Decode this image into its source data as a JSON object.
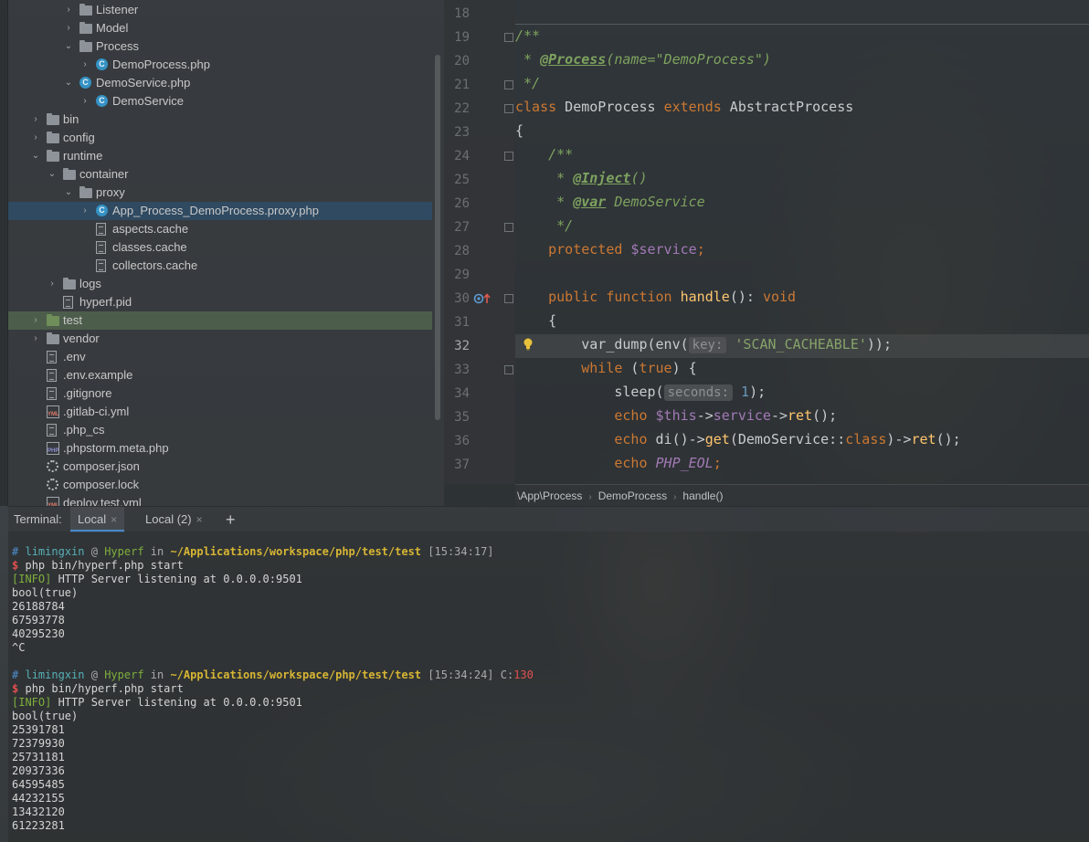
{
  "tree": {
    "items": [
      {
        "label": "Listener",
        "type": "folder",
        "arrow": "›",
        "depth": 3
      },
      {
        "label": "Model",
        "type": "folder",
        "arrow": "›",
        "depth": 3
      },
      {
        "label": "Process",
        "type": "folder",
        "arrow": "⌄",
        "depth": 3
      },
      {
        "label": "DemoProcess.php",
        "type": "class",
        "arrow": "›",
        "depth": 4
      },
      {
        "label": "DemoService.php",
        "type": "class",
        "arrow": "⌄",
        "depth": 3
      },
      {
        "label": "DemoService",
        "type": "class",
        "arrow": "›",
        "depth": 4
      },
      {
        "label": "bin",
        "type": "folder",
        "arrow": "›",
        "depth": 1
      },
      {
        "label": "config",
        "type": "folder",
        "arrow": "›",
        "depth": 1
      },
      {
        "label": "runtime",
        "type": "folder",
        "arrow": "⌄",
        "depth": 1
      },
      {
        "label": "container",
        "type": "folder",
        "arrow": "⌄",
        "depth": 2
      },
      {
        "label": "proxy",
        "type": "folder",
        "arrow": "⌄",
        "depth": 3
      },
      {
        "label": "App_Process_DemoProcess.proxy.php",
        "type": "class",
        "arrow": "›",
        "depth": 4,
        "selected": true
      },
      {
        "label": "aspects.cache",
        "type": "file",
        "arrow": "",
        "depth": 4
      },
      {
        "label": "classes.cache",
        "type": "file",
        "arrow": "",
        "depth": 4
      },
      {
        "label": "collectors.cache",
        "type": "file",
        "arrow": "",
        "depth": 4
      },
      {
        "label": "logs",
        "type": "folder",
        "arrow": "›",
        "depth": 2
      },
      {
        "label": "hyperf.pid",
        "type": "file",
        "arrow": "",
        "depth": 2
      },
      {
        "label": "test",
        "type": "folder-green",
        "arrow": "›",
        "depth": 1,
        "highlight": true
      },
      {
        "label": "vendor",
        "type": "folder",
        "arrow": "›",
        "depth": 1
      },
      {
        "label": ".env",
        "type": "file",
        "arrow": "",
        "depth": 1
      },
      {
        "label": ".env.example",
        "type": "file",
        "arrow": "",
        "depth": 1
      },
      {
        "label": ".gitignore",
        "type": "file",
        "arrow": "",
        "depth": 1
      },
      {
        "label": ".gitlab-ci.yml",
        "type": "yml",
        "arrow": "",
        "depth": 1
      },
      {
        "label": ".php_cs",
        "type": "file",
        "arrow": "",
        "depth": 1
      },
      {
        "label": ".phpstorm.meta.php",
        "type": "php",
        "arrow": "",
        "depth": 1
      },
      {
        "label": "composer.json",
        "type": "gear",
        "arrow": "",
        "depth": 1
      },
      {
        "label": "composer.lock",
        "type": "gear",
        "arrow": "",
        "depth": 1
      },
      {
        "label": "deploy.test.yml",
        "type": "yml",
        "arrow": "",
        "depth": 1
      }
    ]
  },
  "editor": {
    "line_numbers": [
      "18",
      "19",
      "20",
      "21",
      "22",
      "23",
      "24",
      "25",
      "26",
      "27",
      "28",
      "29",
      "30",
      "31",
      "32",
      "33",
      "34",
      "35",
      "36",
      "37"
    ],
    "current_line": "32",
    "lines": {
      "l19": "/**",
      "l20_star": " * ",
      "l20_tag": "@Process",
      "l20_rest": "(name=\"DemoProcess\")",
      "l21": " */",
      "l22_kw": "class",
      "l22_name": " DemoProcess ",
      "l22_kw2": "extends",
      "l22_parent": " AbstractProcess",
      "l23": "{",
      "l24": "    /**",
      "l25_star": "     * ",
      "l25_tag": "@Inject",
      "l25_rest": "()",
      "l26_star": "     * ",
      "l26_tag": "@var",
      "l26_rest": " DemoService",
      "l27": "     */",
      "l28_kw": "    protected",
      "l28_var": " $service",
      "l28_semi": ";",
      "l30_kw": "    public function",
      "l30_fn": " handle",
      "l30_rest": "(): ",
      "l30_void": "void",
      "l31": "    {",
      "l32_pre": "        var_dump(env(",
      "l32_hint": "key:",
      "l32_str": " 'SCAN_CACHEABLE'",
      "l32_post": "));",
      "l33_kw": "        while",
      "l33_mid": " (",
      "l33_true": "true",
      "l33_post": ") {",
      "l34_pre": "            sleep(",
      "l34_hint": "seconds:",
      "l34_num": " 1",
      "l34_post": ");",
      "l35_kw": "            echo",
      "l35_this": " $this",
      "l35_arrow": "->",
      "l35_prop": "service",
      "l35_arrow2": "->",
      "l35_fn": "ret",
      "l35_post": "();",
      "l36_kw": "            echo",
      "l36_mid": " di()->",
      "l36_fn": "get",
      "l36_mid2": "(DemoService::",
      "l36_class": "class",
      "l36_mid3": ")->",
      "l36_fn2": "ret",
      "l36_post": "();",
      "l37_kw": "            echo",
      "l37_const": " PHP_EOL",
      "l37_semi": ";"
    },
    "breadcrumb": [
      "\\App\\Process",
      "DemoProcess",
      "handle()"
    ]
  },
  "terminal": {
    "header_title": "Terminal:",
    "tabs": [
      {
        "label": "Local",
        "close": "×",
        "active": true
      },
      {
        "label": "Local (2)",
        "close": "×",
        "active": false
      }
    ],
    "add_label": "+",
    "session1": {
      "hash": "#",
      "user": "limingxin",
      "at": "@",
      "host": "Hyperf",
      "in": "in",
      "path": "~/Applications/workspace/php/test/test",
      "time": "[15:34:17]",
      "prompt": "$",
      "command": "php bin/hyperf.php start",
      "info_tag": "[INFO]",
      "info_text": " HTTP Server listening at 0.0.0.0:9501",
      "output": [
        "bool(true)",
        "26188784",
        "67593778",
        "40295230",
        "^C"
      ]
    },
    "session2": {
      "hash": "#",
      "user": "limingxin",
      "at": "@",
      "host": "Hyperf",
      "in": "in",
      "path": "~/Applications/workspace/php/test/test",
      "time": "[15:34:24]",
      "code_label": "C:",
      "code_value": "130",
      "prompt": "$",
      "command": "php bin/hyperf.php start",
      "info_tag": "[INFO]",
      "info_text": " HTTP Server listening at 0.0.0.0:9501",
      "output": [
        "bool(true)",
        "25391781",
        "72379930",
        "25731181",
        "20937336",
        "64595485",
        "44232155",
        "13432120",
        "61223281"
      ]
    }
  },
  "colors": {
    "selection": "#2f4a61",
    "accent": "#4a88c7",
    "keyword": "#cc7832",
    "doc_comment": "#7ea35f"
  }
}
